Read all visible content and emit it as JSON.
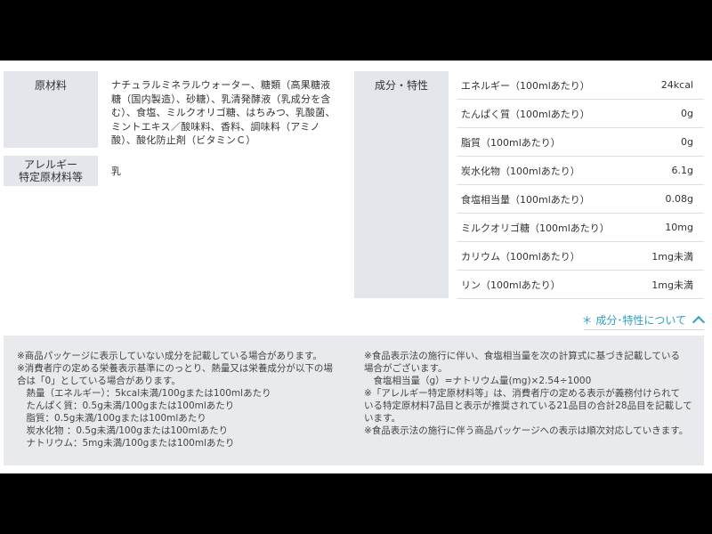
{
  "materials": {
    "label": "原材料",
    "text": "ナチュラルミネラルウォーター、糖類（高果糖液糖（国内製造）、砂糖）、乳清発酵液（乳成分を含む）、食塩、ミルクオリゴ糖、はちみつ、乳酸菌、ミントエキス／酸味料、香料、調味料（アミノ酸）、酸化防止剤（ビタミンＣ）"
  },
  "allergy": {
    "label_line1": "アレルギー",
    "label_line2": "特定原材料等",
    "value": "乳"
  },
  "properties": {
    "label": "成分・特性",
    "rows": [
      {
        "name": "エネルギー（100mlあたり）",
        "value": "24kcal"
      },
      {
        "name": "たんぱく質（100mlあたり）",
        "value": "0g"
      },
      {
        "name": "脂質（100mlあたり）",
        "value": "0g"
      },
      {
        "name": "炭水化物（100mlあたり）",
        "value": "6.1g"
      },
      {
        "name": "食塩相当量（100mlあたり）",
        "value": "0.08g"
      },
      {
        "name": "ミルクオリゴ糖（100mlあたり）",
        "value": "10mg"
      },
      {
        "name": "カリウム（100mlあたり）",
        "value": "1mg未満"
      },
      {
        "name": "リン（100mlあたり）",
        "value": "1mg未満"
      }
    ],
    "link_label": "＊ 成分･特性について"
  },
  "notes": {
    "left": [
      "※商品パッケージに表示していない成分を記載している場合があります。",
      "※消費者庁の定める栄養表示基準にのっとり、熱量又は栄養成分が以下の場",
      "合は「0」としている場合があります。",
      "　熱量（エネルギー）：5kcal未満/100gまたは100mlあたり",
      "　たんぱく質：0.5g未満/100gまたは100mlあたり",
      "　脂質：0.5g未満/100gまたは100mlあたり",
      "　炭水化物 ：0.5g未満/100gまたは100mlあたり",
      "　ナトリウム：5mg未満/100gまたは100mlあたり"
    ],
    "right": [
      "※食品表示法の施行に伴い、食塩相当量を次の計算式に基づき記載している",
      "場合がございます。",
      "　食塩相当量（g）=ナトリウム量(mg)×2.54÷1000",
      "※「アレルギー特定原材料等」は、消費者庁の定める表示が義務付けられて",
      "いる特定原材料7品目と表示が推奨されている21品目の合計28品目を記載して",
      "います。",
      "※食品表示法の施行に伴う商品パッケージへの表示は順次対応していきます。"
    ]
  }
}
